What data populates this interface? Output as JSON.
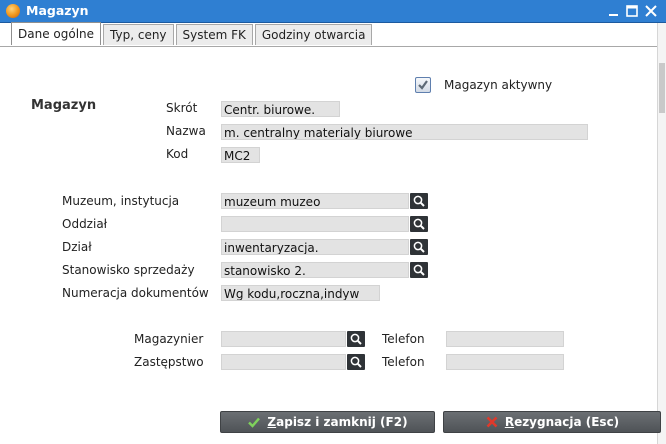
{
  "window": {
    "title": "Magazyn"
  },
  "tabs": [
    "Dane ogólne",
    "Typ, ceny",
    "System FK",
    "Godziny otwarcia"
  ],
  "active": {
    "label": "Magazyn aktywny",
    "checked": true
  },
  "section": {
    "title": "Magazyn"
  },
  "fields": {
    "skrot": {
      "label": "Skrót",
      "value": "Centr. biurowe."
    },
    "nazwa": {
      "label": "Nazwa",
      "value": "m. centralny materialy biurowe"
    },
    "kod": {
      "label": "Kod",
      "value": "MC2"
    },
    "muzeum": {
      "label": "Muzeum, instytucja",
      "value": "muzeum muzeo"
    },
    "oddzial": {
      "label": "Oddział",
      "value": ""
    },
    "dzial": {
      "label": "Dział",
      "value": "inwentaryzacja."
    },
    "stanowisko": {
      "label": "Stanowisko sprzedaży",
      "value": "stanowisko 2."
    },
    "numeracja": {
      "label": "Numeracja dokumentów",
      "value": "Wg kodu,roczna,indyw"
    },
    "magazynier": {
      "label": "Magazynier",
      "value": ""
    },
    "zastepstwo": {
      "label": "Zastępstwo",
      "value": ""
    },
    "telefon1": {
      "label": "Telefon",
      "value": ""
    },
    "telefon2": {
      "label": "Telefon",
      "value": ""
    }
  },
  "buttons": {
    "save": {
      "underlined": "Z",
      "rest": "apisz i zamknij (F2)"
    },
    "cancel": {
      "underlined": "R",
      "rest": "ezygnacja (Esc)"
    }
  }
}
